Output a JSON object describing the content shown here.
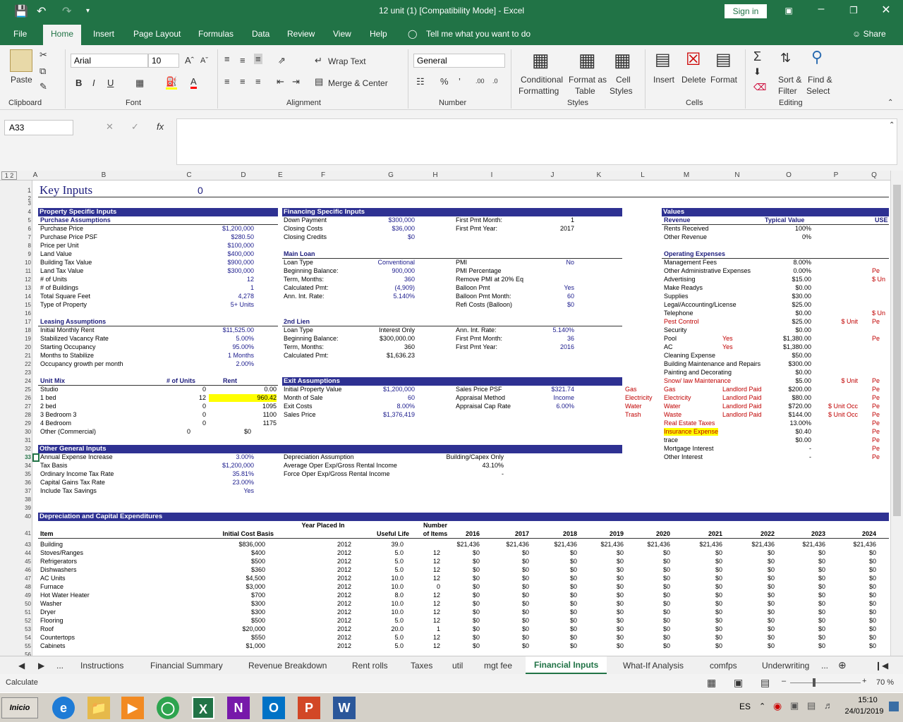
{
  "app": {
    "title": "12 unit (1)  [Compatibility Mode]  -  Excel",
    "sign_in": "Sign in",
    "share": "Share",
    "tell_me": "Tell me what you want to do"
  },
  "menu_tabs": [
    "File",
    "Home",
    "Insert",
    "Page Layout",
    "Formulas",
    "Data",
    "Review",
    "View",
    "Help"
  ],
  "ribbon": {
    "paste": "Paste",
    "font_name": "Arial",
    "font_size": "10",
    "wrap_text": "Wrap Text",
    "merge_center": "Merge & Center",
    "number_format": "General",
    "conditional": "Conditional",
    "formatting": "Formatting",
    "format_as": "Format as",
    "table": "Table",
    "cell": "Cell",
    "styles_lbl": "Styles",
    "insert": "Insert",
    "delete": "Delete",
    "format": "Format",
    "sort": "Sort &",
    "filter": "Filter",
    "find": "Find &",
    "select": "Select",
    "groups": {
      "clipboard": "Clipboard",
      "font": "Font",
      "alignment": "Alignment",
      "number": "Number",
      "styles": "Styles",
      "cells": "Cells",
      "editing": "Editing"
    }
  },
  "formula_bar": {
    "name_box": "A33",
    "fx": "fx"
  },
  "columns": [
    "A",
    "B",
    "C",
    "D",
    "E",
    "F",
    "G",
    "H",
    "I",
    "J",
    "K",
    "L",
    "M",
    "N",
    "O",
    "P",
    "Q"
  ],
  "row_numbers": [
    "1",
    "2",
    "3",
    "4",
    "5",
    "6",
    "7",
    "8",
    "9",
    "10",
    "11",
    "12",
    "13",
    "14",
    "15",
    "16",
    "17",
    "18",
    "19",
    "20",
    "21",
    "22",
    "23",
    "24",
    "25",
    "26",
    "27",
    "28",
    "29",
    "30",
    "31",
    "32",
    "33",
    "34",
    "35",
    "36",
    "37",
    "38",
    "39",
    "40",
    "41",
    "43",
    "44",
    "45",
    "46",
    "47",
    "48",
    "49",
    "50",
    "51",
    "52",
    "53",
    "54",
    "55",
    "56"
  ],
  "sheet": {
    "key_inputs": "Key Inputs",
    "key_val": "0",
    "property": {
      "header": "Property Specific Inputs",
      "purchase": "Purchase Assumptions",
      "rows": [
        [
          "Purchase Price",
          "$1,200,000"
        ],
        [
          "Purchase Price PSF",
          "$280.50"
        ],
        [
          "Price per Unit",
          "$100,000"
        ],
        [
          "Land Value",
          "$400,000"
        ],
        [
          "Building Tax Value",
          "$900,000"
        ],
        [
          "Land Tax Value",
          "$300,000"
        ],
        [
          "# of Units",
          "12"
        ],
        [
          "# of Buildings",
          "1"
        ],
        [
          "Total Square Feet",
          "4,278"
        ],
        [
          "Type of Property",
          "5+ Units"
        ]
      ],
      "leasing": "Leasing Assumptions",
      "leasing_rows": [
        [
          "Initial Monthly Rent",
          "$11,525.00"
        ],
        [
          "Stabilized Vacancy Rate",
          "5.00%"
        ],
        [
          "Starting Occupancy",
          "95.00%"
        ],
        [
          "Months to Stabilize",
          "1 Months"
        ],
        [
          "Occupancy growth per month",
          "2.00%"
        ]
      ],
      "unit_mix": "Unit Mix",
      "num_units": "# of Units",
      "rent": "Rent",
      "mix_rows": [
        [
          "Studio",
          "0",
          "0.00"
        ],
        [
          "1 bed",
          "12",
          "960.42"
        ],
        [
          "2 bed",
          "0",
          "1095"
        ],
        [
          "3 Bedroom 3",
          "0",
          "1100"
        ],
        [
          "4 Bedroom",
          "0",
          "1175"
        ]
      ],
      "other_comm": "Other (Commercial)",
      "other_comm_c": "0",
      "other_comm_d": "$0"
    },
    "financing": {
      "header": "Financing Specific Inputs",
      "rows": [
        [
          "Down Payment",
          "$300,000"
        ],
        [
          "Closing Costs",
          "$36,000"
        ],
        [
          "Closing Credits",
          "$0"
        ]
      ],
      "first_pmt_month": "First Pmt Month:",
      "first_pmt_month_v": "1",
      "first_pmt_year": "First Pmt Year:",
      "first_pmt_year_v": "2017",
      "main_loan": "Main Loan",
      "loan_rows": [
        [
          "Loan Type",
          "Conventional"
        ],
        [
          "Beginning Balance:",
          "900,000"
        ],
        [
          "Term, Months:",
          "360"
        ],
        [
          "Calculated Pmt:",
          "(4,909)"
        ],
        [
          "Ann. Int. Rate:",
          "5.140%"
        ]
      ],
      "loan_right": [
        [
          "PMI",
          "No"
        ],
        [
          "PMI Percentage",
          ""
        ],
        [
          "Remove PMI at 20% Eq",
          ""
        ],
        [
          "Balloon Pmt",
          "Yes"
        ],
        [
          "Balloon Pmt Month:",
          "60"
        ],
        [
          "Refi Costs (Balloon)",
          "$0"
        ]
      ],
      "lien": "2nd Lien",
      "lien_rows": [
        [
          "Loan Type",
          "Interest Only"
        ],
        [
          "Beginning Balance:",
          "$300,000.00"
        ],
        [
          "Term, Months:",
          "360"
        ],
        [
          "Calculated Pmt:",
          "$1,636.23"
        ]
      ],
      "lien_right": [
        [
          "Ann. Int. Rate:",
          "5.140%"
        ],
        [
          "First Pmt Month:",
          "36"
        ],
        [
          "First Pmt Year:",
          "2016"
        ]
      ]
    },
    "exit": {
      "header": "Exit Assumptions",
      "rows": [
        [
          "Initial Property Value",
          "$1,200,000"
        ],
        [
          "Month of Sale",
          "60"
        ],
        [
          "Exit Costs",
          "8.00%"
        ],
        [
          "Sales Price",
          "$1,376,419"
        ]
      ],
      "right": [
        [
          "Sales Price PSF",
          "$321.74"
        ],
        [
          "Appraisal Method",
          "Income"
        ],
        [
          "Appraisal Cap Rate",
          "6.00%"
        ]
      ],
      "utilities": [
        "Gas",
        "Electricity",
        "Water",
        "Trash"
      ]
    },
    "other": {
      "header": "Other General Inputs",
      "rows": [
        [
          "Annual Expense Increase",
          "3.00%"
        ],
        [
          "Tax Basis",
          "$1,200,000"
        ],
        [
          "Ordinary Income Tax Rate",
          "35.81%"
        ],
        [
          "Capital Gains Tax Rate",
          "23.00%"
        ],
        [
          "Include Tax Savings",
          "Yes"
        ]
      ],
      "right": [
        [
          "Depreciation Assumption",
          "Building/Capex Only"
        ],
        [
          "Average Oper Exp/Gross Rental Income",
          "43.10%"
        ],
        [
          "Force Oper Exp/Gross Rental Income",
          "-"
        ]
      ]
    },
    "values": {
      "header": "Values",
      "revenue": "Revenue",
      "typical": "Typical Value",
      "use": "USE",
      "rev_rows": [
        [
          "Rents Received",
          "100%"
        ],
        [
          "Other Revenue",
          "0%"
        ]
      ],
      "opex": "Operating Expenses",
      "opex_rows": [
        [
          "Management Fees",
          "",
          "8.00%",
          "",
          ""
        ],
        [
          "Other Administrative Expenses",
          "",
          "0.00%",
          "",
          "Pe"
        ],
        [
          "Advertising",
          "",
          "$15.00",
          "",
          "$ Un"
        ],
        [
          "Make Readys",
          "",
          "$0.00",
          "",
          ""
        ],
        [
          "Supplies",
          "",
          "$30.00",
          "",
          ""
        ],
        [
          "Legal/Accounting/License",
          "",
          "$25.00",
          "",
          ""
        ],
        [
          "Telephone",
          "",
          "$0.00",
          "",
          "$ Un"
        ],
        [
          "Pest Control",
          "",
          "$25.00",
          "$ Unit",
          "Pe"
        ],
        [
          "Security",
          "",
          "$0.00",
          "",
          ""
        ],
        [
          "Pool",
          "Yes",
          "$1,380.00",
          "",
          "Pe"
        ],
        [
          "AC",
          "Yes",
          "$1,380.00",
          "",
          ""
        ],
        [
          "Cleaning Expense",
          "",
          "$50.00",
          "",
          ""
        ],
        [
          "Building Maintenance and Repairs",
          "",
          "$300.00",
          "",
          ""
        ],
        [
          "Painting and Decorating",
          "",
          "$0.00",
          "",
          ""
        ],
        [
          "Snow/ law Maintenance",
          "",
          "$5.00",
          "$ Unit",
          "Pe"
        ],
        [
          "Gas",
          "Landlord Paid",
          "$200.00",
          "",
          "Pe"
        ],
        [
          "Electricity",
          "Landlord Paid",
          "$80.00",
          "",
          "Pe"
        ],
        [
          "Water",
          "Landlord Paid",
          "$720.00",
          "$ Unit Occ",
          "Pe"
        ],
        [
          "Waste",
          "Landlord Paid",
          "$144.00",
          "$ Unit Occ",
          "Pe"
        ],
        [
          "Real Estate Taxes",
          "",
          "13.00%",
          "",
          "Pe"
        ],
        [
          "Insurance Expense",
          "",
          "$0.40",
          "",
          "Pe"
        ],
        [
          "trace",
          "",
          "$0.00",
          "",
          "Pe"
        ],
        [
          "Mortgage Interest",
          "",
          "-",
          "",
          "Pe"
        ],
        [
          "Other Interest",
          "",
          "-",
          "",
          "Pe"
        ]
      ]
    },
    "depr": {
      "header": "Depreciation and Capital Expenditures",
      "col_item": "Item",
      "col_basis": "Initial Cost Basis",
      "col_year1": "Year Placed In",
      "col_year2": "Service",
      "col_life": "Useful Life",
      "col_num1": "Number",
      "col_num2": "of Items",
      "years": [
        "2016",
        "2017",
        "2018",
        "2019",
        "2020",
        "2021",
        "2022",
        "2023",
        "2024"
      ],
      "rows": [
        [
          "Building",
          "$836,000",
          "2012",
          "39.0",
          "",
          "$21,436"
        ],
        [
          "Stoves/Ranges",
          "$400",
          "2012",
          "5.0",
          "12",
          "$0"
        ],
        [
          "Refrigerators",
          "$500",
          "2012",
          "5.0",
          "12",
          "$0"
        ],
        [
          "Dishwashers",
          "$360",
          "2012",
          "5.0",
          "12",
          "$0"
        ],
        [
          "AC Units",
          "$4,500",
          "2012",
          "10.0",
          "12",
          "$0"
        ],
        [
          "Furnace",
          "$3,000",
          "2012",
          "10.0",
          "0",
          "$0"
        ],
        [
          "Hot Water Heater",
          "$700",
          "2012",
          "8.0",
          "12",
          "$0"
        ],
        [
          "Washer",
          "$300",
          "2012",
          "10.0",
          "12",
          "$0"
        ],
        [
          "Dryer",
          "$300",
          "2012",
          "10.0",
          "12",
          "$0"
        ],
        [
          "Flooring",
          "$500",
          "2012",
          "5.0",
          "12",
          "$0"
        ],
        [
          "Roof",
          "$20,000",
          "2012",
          "20.0",
          "1",
          "$0"
        ],
        [
          "Countertops",
          "$550",
          "2012",
          "5.0",
          "12",
          "$0"
        ],
        [
          "Cabinets",
          "$1,000",
          "2012",
          "5.0",
          "12",
          "$0"
        ]
      ]
    }
  },
  "sheet_tabs": [
    "...",
    "Instructions",
    "Financial Summary",
    "Revenue Breakdown",
    "Rent rolls",
    "Taxes",
    "util",
    "mgt fee",
    "Financial Inputs",
    "What-If Analysis",
    "comfps",
    "Underwriting",
    "..."
  ],
  "status": {
    "mode": "Calculate",
    "zoom": "70 %"
  },
  "taskbar": {
    "start": "Inicio",
    "lang": "ES",
    "time": "15:10",
    "date": "24/01/2019"
  }
}
